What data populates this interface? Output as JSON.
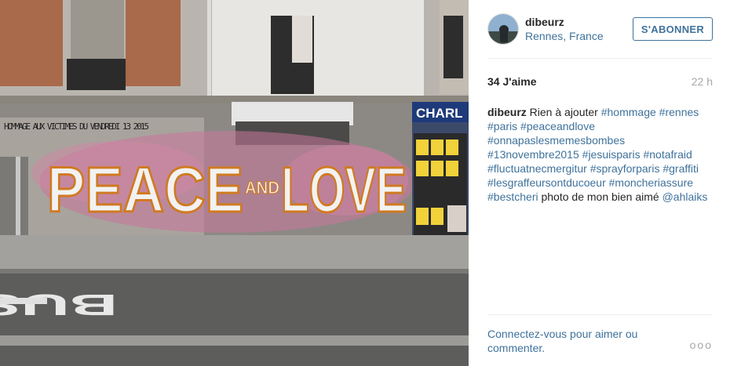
{
  "post": {
    "username": "dibeurz",
    "location": "Rennes, France",
    "follow_label": "S'ABONNER",
    "likes": "34 J'aime",
    "time": "22 h",
    "caption": {
      "author": "dibeurz",
      "text": "Rien à ajouter",
      "hashtags": [
        "#hommage",
        "#rennes",
        "#paris",
        "#peaceandlove",
        "#onnapaslesmemesbombes",
        "#13novembre2015",
        "#jesuisparis",
        "#notafraid",
        "#fluctuatnecmergitur",
        "#sprayforparis",
        "#graffiti",
        "#lesgraffeursontducoeur",
        "#moncheriassure",
        "#bestcheri"
      ],
      "trailing_text": "photo de mon bien aimé",
      "mention": "@ahlaiks"
    },
    "login_prompt": "Connectez-vous pour aimer ou commenter.",
    "more_label": "ooo"
  },
  "photo": {
    "graffiti_main": "PEACE",
    "graffiti_and": "AND",
    "graffiti_love": "LOVE",
    "wall_text": "HOMMAGE AUX VICTIMES DU VENDREDI 13 2015",
    "shop_sign": "CHARL",
    "road_text": "BUS"
  }
}
